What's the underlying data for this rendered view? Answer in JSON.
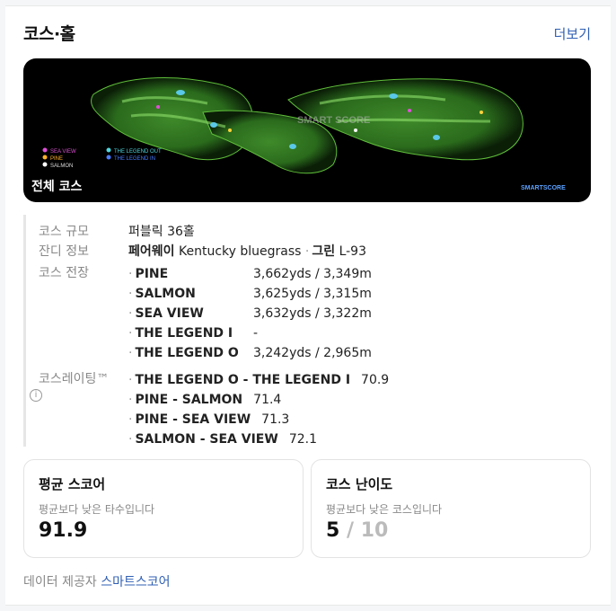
{
  "header": {
    "title": "코스·홀",
    "more_label": "더보기"
  },
  "map": {
    "caption": "전체 코스",
    "overlay_text": "SMART SCORE",
    "watermark": "SMARTSCORE",
    "legend": [
      "SEA VIEW",
      "THE LEGEND OUT",
      "PINE",
      "THE LEGEND IN",
      "SALMON"
    ]
  },
  "info": {
    "scale": {
      "label": "코스 규모",
      "value": "퍼블릭 36홀"
    },
    "grass": {
      "label": "잔디 정보",
      "fairway": "페어웨이",
      "fairway_type": "Kentucky bluegrass",
      "sep": "·",
      "green": "그린",
      "green_type": "L-93"
    },
    "length": {
      "label": "코스 전장",
      "items": [
        {
          "name": "PINE",
          "value": "3,662yds / 3,349m"
        },
        {
          "name": "SALMON",
          "value": "3,625yds / 3,315m"
        },
        {
          "name": "SEA VIEW",
          "value": "3,632yds / 3,322m"
        },
        {
          "name": "THE LEGEND I",
          "value": "-"
        },
        {
          "name": "THE LEGEND O",
          "value": "3,242yds / 2,965m"
        }
      ]
    },
    "rating": {
      "label": "코스레이팅™",
      "items": [
        {
          "name": "THE LEGEND O - THE LEGEND I",
          "value": "70.9"
        },
        {
          "name": "PINE - SALMON",
          "value": "71.4"
        },
        {
          "name": "PINE - SEA VIEW",
          "value": "71.3"
        },
        {
          "name": "SALMON - SEA VIEW",
          "value": "72.1"
        }
      ]
    }
  },
  "score_box": {
    "title": "평균 스코어",
    "desc": "평균보다 낮은 타수입니다",
    "value": "91.9"
  },
  "difficulty_box": {
    "title": "코스 난이도",
    "desc": "평균보다 낮은 코스입니다",
    "value": "5",
    "slash": "/",
    "total": "10"
  },
  "footer": {
    "prefix": "데이터 제공자",
    "provider": "스마트스코어"
  }
}
